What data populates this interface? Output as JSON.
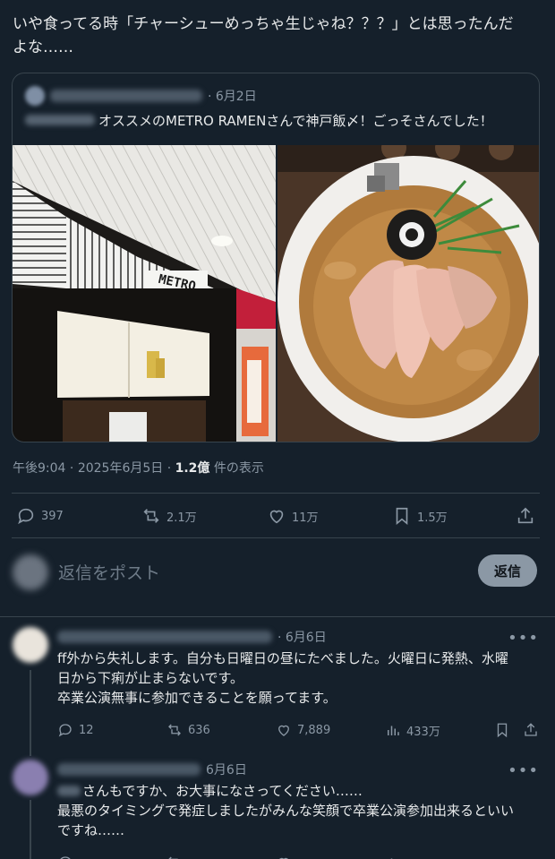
{
  "post": {
    "text_line1": "いや食ってる時「チャーシューめっちゃ生じゃね？？？」とは思ったんだ",
    "text_line2": "よな……"
  },
  "quote": {
    "date": "· 6月2日",
    "text": "オススメのMETRO RAMENさんで神戸飯〆！ごっそさんでした！",
    "sign_text": "METRO RAMEN"
  },
  "meta": {
    "time": "午後9:04",
    "sep1": " · ",
    "date": "2025年6月5日",
    "sep2": " · ",
    "views": "1.2億",
    "views_label": " 件の表示"
  },
  "actions": {
    "reply_count": "397",
    "repost_count": "2.1万",
    "like_count": "11万",
    "bookmark_count": "1.5万"
  },
  "reply_composer": {
    "placeholder": "返信をポスト",
    "button_label": "返信"
  },
  "replies": [
    {
      "date": "· 6月6日",
      "line1": "ff外から失礼します。自分も日曜日の昼にたべました。火曜日に発熱、水曜",
      "line2": "日から下痢が止まらないです。",
      "line3": "卒業公演無事に参加できることを願ってます。",
      "reply_count": "12",
      "repost_count": "636",
      "like_count": "7,889",
      "view_count": "433万"
    },
    {
      "date": "6月6日",
      "line1": "さんもですか、お大事になさってください……",
      "line2": "最悪のタイミングで発症しましたがみんな笑顔で卒業公演参加出来るといい",
      "line3": "ですね……"
    }
  ],
  "icons": {
    "reply": "reply-icon",
    "repost": "repost-icon",
    "like": "heart-icon",
    "bookmark": "bookmark-icon",
    "share": "share-icon",
    "views": "views-icon",
    "more": "more-icon"
  },
  "colors": {
    "background": "#15202b",
    "text": "#e7e9ea",
    "muted": "#8b98a5",
    "border": "#38444d"
  }
}
